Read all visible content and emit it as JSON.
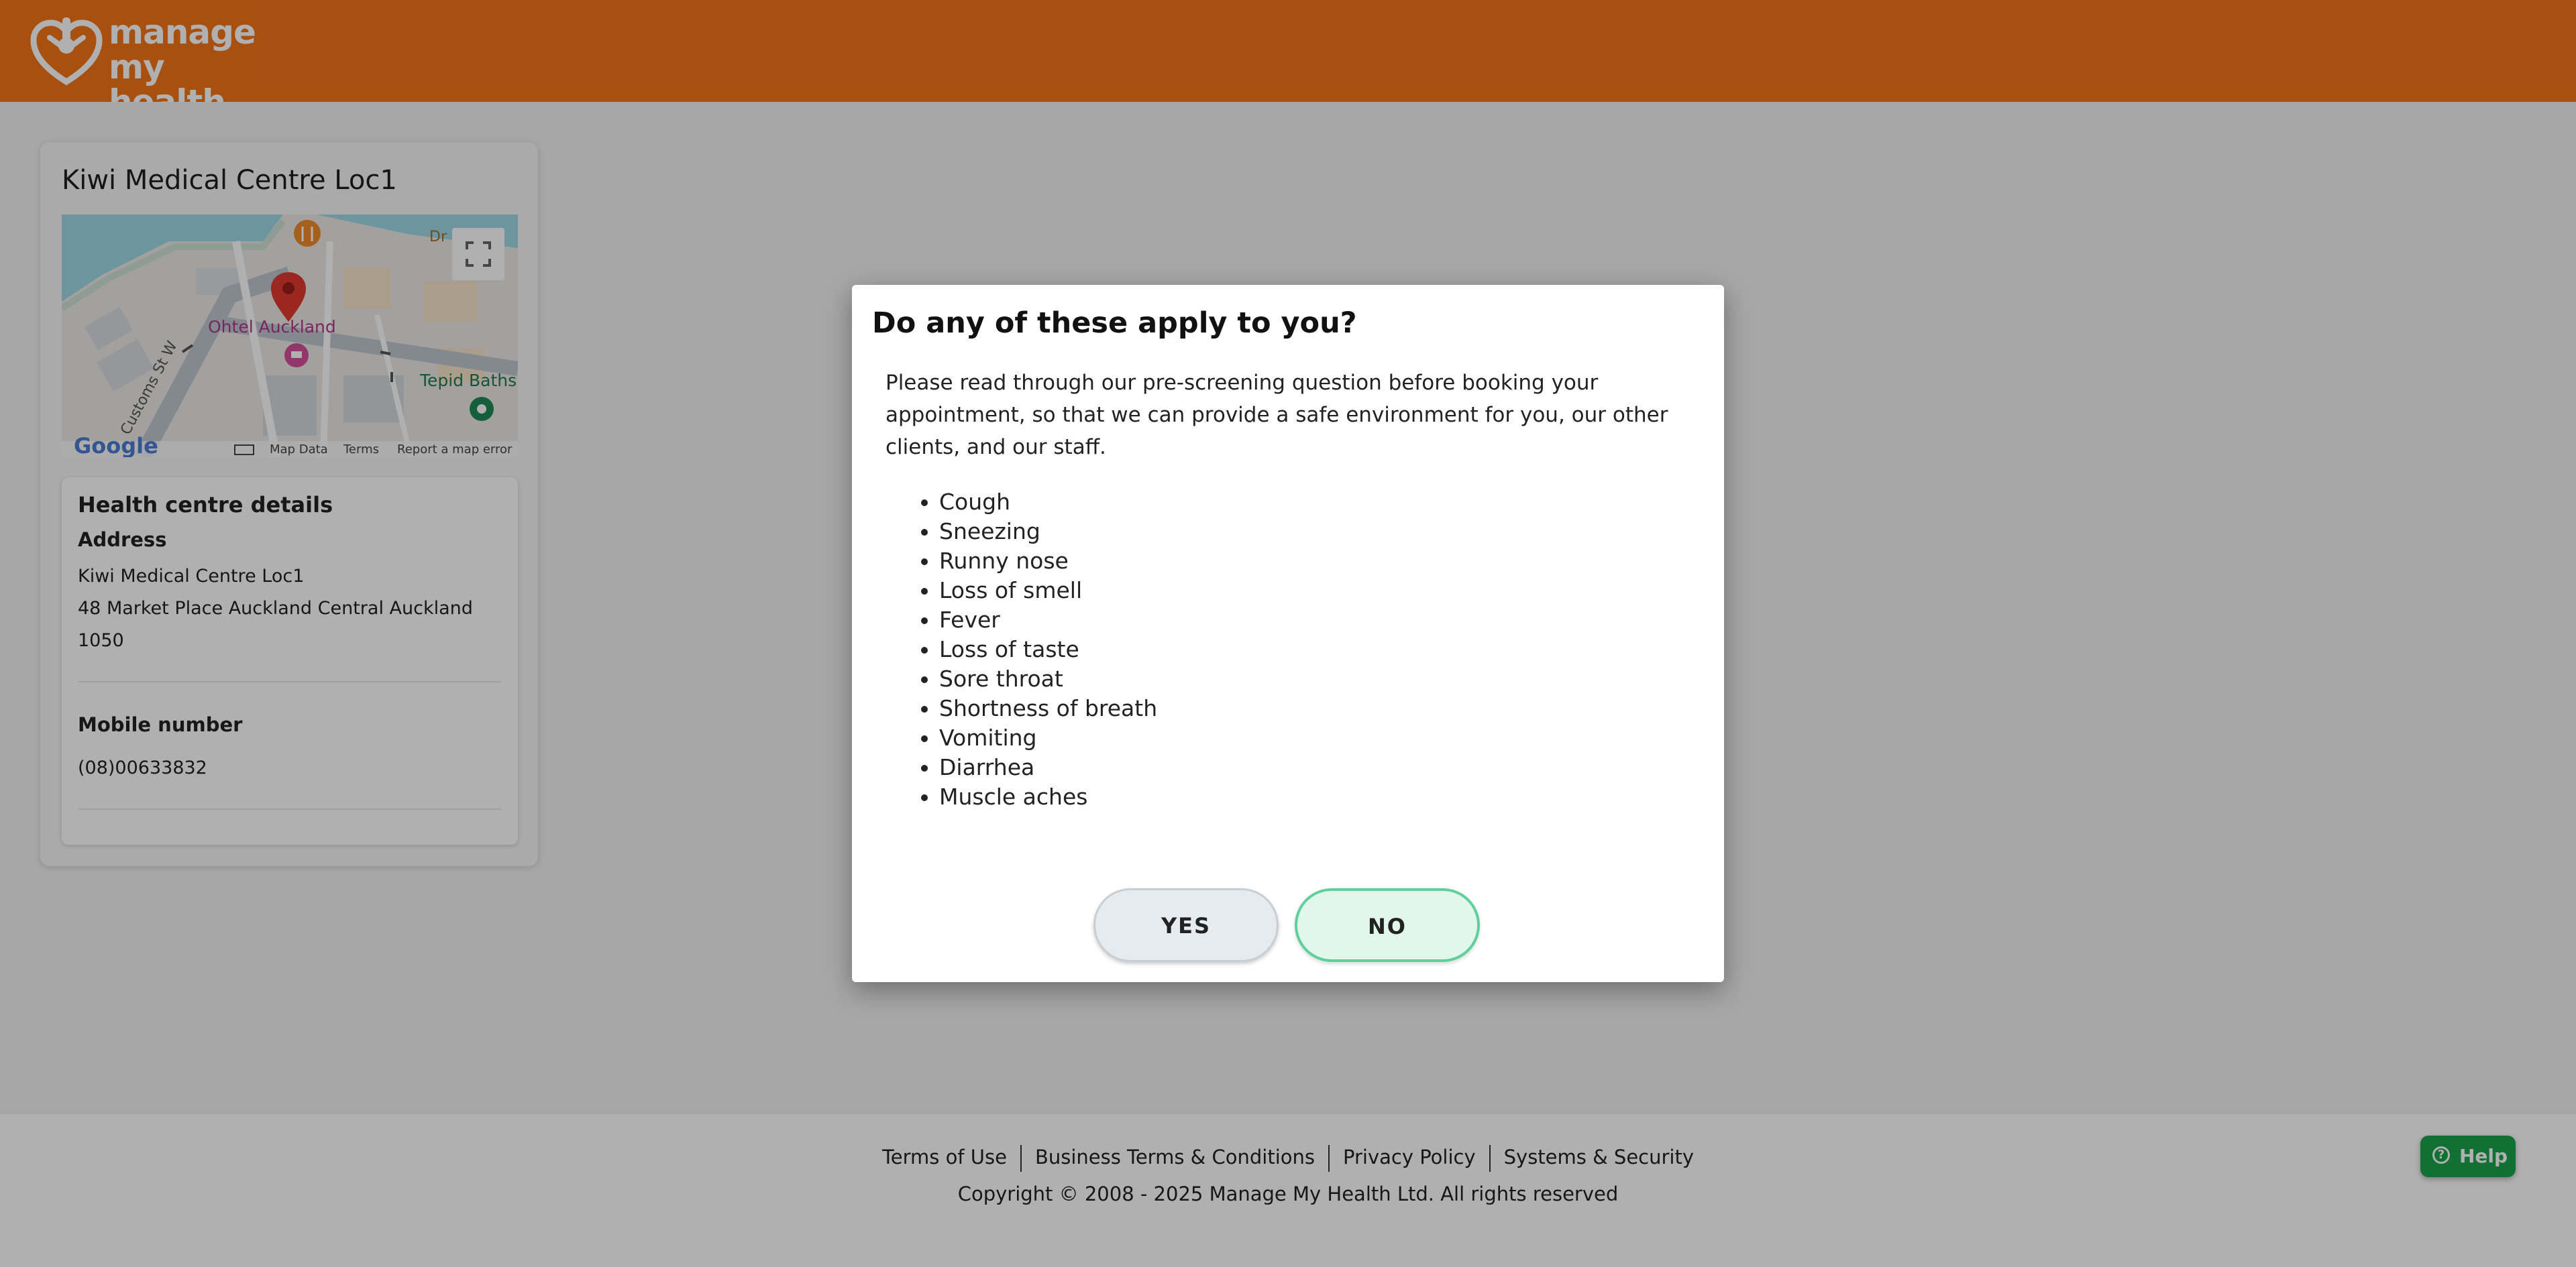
{
  "header": {
    "logo_line1": "manage",
    "logo_line2": "my health"
  },
  "card": {
    "title": "Kiwi Medical Centre Loc1",
    "map": {
      "poi_hotel": "Ohtel Auckland",
      "poi_baths": "Tepid Baths",
      "street": "Customs St W",
      "poi_partial": "Dr",
      "brand": "Google",
      "map_data": "Map Data",
      "terms": "Terms",
      "report": "Report a map error"
    },
    "details": {
      "title": "Health centre details",
      "address_label": "Address",
      "address_lines": [
        "Kiwi Medical Centre Loc1",
        "48 Market Place Auckland Central Auckland",
        "1050"
      ],
      "mobile_label": "Mobile number",
      "mobile_value": "(08)00633832"
    }
  },
  "modal": {
    "title": "Do any of these apply to you?",
    "body": "Please read through our pre-screening question before booking your appointment, so that we can provide a safe environment for you, our other clients, and our staff.",
    "symptoms": [
      "Cough",
      "Sneezing",
      "Runny nose",
      "Loss of smell",
      "Fever",
      "Loss of taste",
      "Sore throat",
      "Shortness of breath",
      "Vomiting",
      "Diarrhea",
      "Muscle aches"
    ],
    "yes_label": "YES",
    "no_label": "NO"
  },
  "footer": {
    "links": [
      "Terms of Use",
      "Business Terms & Conditions",
      "Privacy Policy",
      "Systems & Security"
    ],
    "copyright": "Copyright © 2008 - 2025 Manage My Health Ltd. All rights reserved"
  },
  "help": {
    "label": "Help",
    "icon": "question-circle-icon"
  },
  "colors": {
    "header": "#f47418",
    "help": "#1aa34a",
    "no_border": "#5fcf9c",
    "no_bg": "#e1f7ec",
    "yes_bg": "#e6ebf0"
  }
}
